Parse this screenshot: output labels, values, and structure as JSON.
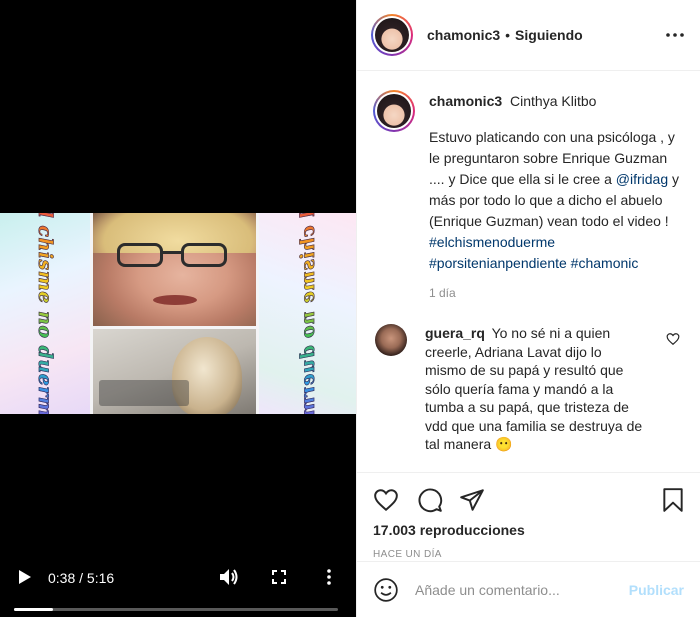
{
  "video": {
    "side_text_left": "el chisme no duerme",
    "side_text_right": "el chisme no duerme",
    "time_display": "0:38 / 5:16",
    "progress_fraction": 0.12
  },
  "header": {
    "username": "chamonic3",
    "separator": "•",
    "follow_status": "Siguiendo"
  },
  "caption": {
    "username": "chamonic3",
    "display_name": "Cinthya Klitbo",
    "text_part1": "Estuvo platicando con una psicóloga , y le preguntaron sobre Enrique Guzman .... y Dice que ella si le cree a ",
    "mention": "@ifridag",
    "text_part2": " y más por todo lo que a dicho el abuelo (Enrique Guzman) vean todo el video ! ",
    "hashtag1": "#elchismenoduerme",
    "hashtag2": "#porsitenianpendiente",
    "hashtag3": "#chamonic",
    "time": "1 día"
  },
  "comments": [
    {
      "username": "guera_rq",
      "text": "Yo no sé ni a quien creerle, Adriana Lavat dijo lo mismo de su papá y resultó que sólo quería fama y mandó a la tumba a su papá, que tristeza de vdd que una familia se destruya de tal manera 😶"
    }
  ],
  "stats": {
    "views_count": "17.003",
    "views_label": "reproducciones",
    "posted": "HACE UN DÍA"
  },
  "composer": {
    "placeholder": "Añade un comentario...",
    "publish_label": "Publicar"
  },
  "colors": {
    "link": "#00376b",
    "muted": "#8e8e8e",
    "publish_disabled": "#b2dffc"
  }
}
